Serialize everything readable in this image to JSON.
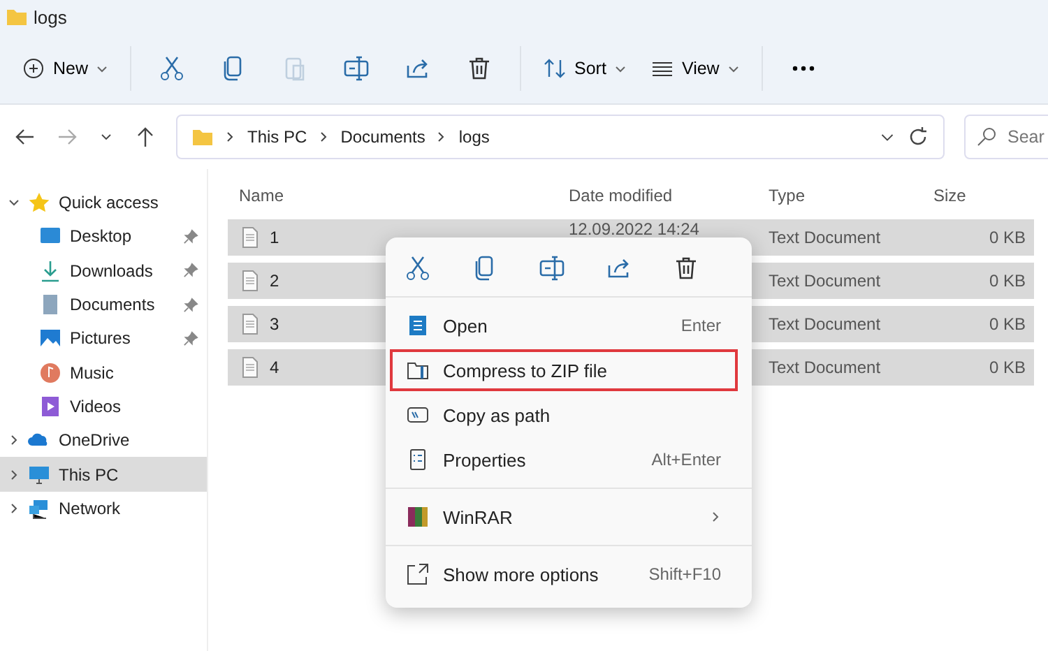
{
  "window": {
    "title": "logs"
  },
  "toolbar": {
    "new_label": "New",
    "sort_label": "Sort",
    "view_label": "View",
    "paste_disabled": true
  },
  "address": {
    "crumbs": [
      "This PC",
      "Documents",
      "logs"
    ]
  },
  "search": {
    "placeholder": "Sear"
  },
  "sidebar": {
    "items": [
      {
        "label": "Quick access",
        "expanded": true,
        "selected": false,
        "children": [
          {
            "label": "Desktop",
            "pinned": true
          },
          {
            "label": "Downloads",
            "pinned": true
          },
          {
            "label": "Documents",
            "pinned": true
          },
          {
            "label": "Pictures",
            "pinned": true
          },
          {
            "label": "Music",
            "pinned": false
          },
          {
            "label": "Videos",
            "pinned": false
          }
        ]
      },
      {
        "label": "OneDrive",
        "expanded": false,
        "selected": false
      },
      {
        "label": "This PC",
        "expanded": false,
        "selected": true
      },
      {
        "label": "Network",
        "expanded": false,
        "selected": false
      }
    ]
  },
  "table": {
    "columns": [
      "Name",
      "Date modified",
      "Type",
      "Size"
    ],
    "rows": [
      {
        "name": "1",
        "date": "12.09.2022 14:24",
        "type": "Text Document",
        "size": "0 KB",
        "selected": true
      },
      {
        "name": "2",
        "type": "Text Document",
        "size": "0 KB",
        "selected": true
      },
      {
        "name": "3",
        "type": "Text Document",
        "size": "0 KB",
        "selected": true
      },
      {
        "name": "4",
        "type": "Text Document",
        "size": "0 KB",
        "selected": true
      }
    ]
  },
  "context_menu": {
    "groups": [
      [
        {
          "label": "Open",
          "shortcut": "Enter",
          "highlighted": false
        },
        {
          "label": "Compress to ZIP file",
          "highlighted": true
        },
        {
          "label": "Copy as path",
          "highlighted": false
        },
        {
          "label": "Properties",
          "shortcut": "Alt+Enter",
          "highlighted": false
        }
      ],
      [
        {
          "label": "WinRAR",
          "submenu": true,
          "highlighted": false
        }
      ],
      [
        {
          "label": "Show more options",
          "shortcut": "Shift+F10",
          "highlighted": false
        }
      ]
    ]
  }
}
